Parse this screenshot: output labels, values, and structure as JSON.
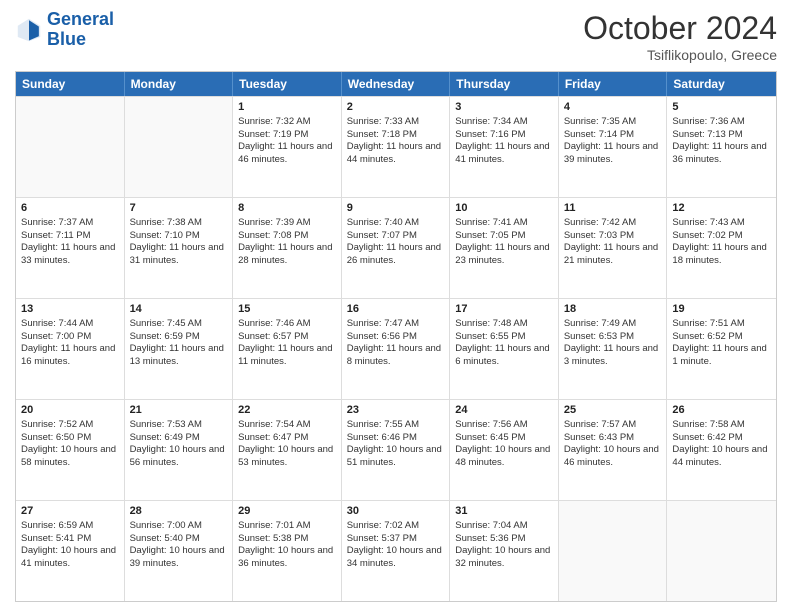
{
  "header": {
    "logo_general": "General",
    "logo_blue": "Blue",
    "month_title": "October 2024",
    "location": "Tsiflikopoulo, Greece"
  },
  "days_of_week": [
    "Sunday",
    "Monday",
    "Tuesday",
    "Wednesday",
    "Thursday",
    "Friday",
    "Saturday"
  ],
  "weeks": [
    [
      {
        "day": "",
        "sunrise": "",
        "sunset": "",
        "daylight": ""
      },
      {
        "day": "",
        "sunrise": "",
        "sunset": "",
        "daylight": ""
      },
      {
        "day": "1",
        "sunrise": "Sunrise: 7:32 AM",
        "sunset": "Sunset: 7:19 PM",
        "daylight": "Daylight: 11 hours and 46 minutes."
      },
      {
        "day": "2",
        "sunrise": "Sunrise: 7:33 AM",
        "sunset": "Sunset: 7:18 PM",
        "daylight": "Daylight: 11 hours and 44 minutes."
      },
      {
        "day": "3",
        "sunrise": "Sunrise: 7:34 AM",
        "sunset": "Sunset: 7:16 PM",
        "daylight": "Daylight: 11 hours and 41 minutes."
      },
      {
        "day": "4",
        "sunrise": "Sunrise: 7:35 AM",
        "sunset": "Sunset: 7:14 PM",
        "daylight": "Daylight: 11 hours and 39 minutes."
      },
      {
        "day": "5",
        "sunrise": "Sunrise: 7:36 AM",
        "sunset": "Sunset: 7:13 PM",
        "daylight": "Daylight: 11 hours and 36 minutes."
      }
    ],
    [
      {
        "day": "6",
        "sunrise": "Sunrise: 7:37 AM",
        "sunset": "Sunset: 7:11 PM",
        "daylight": "Daylight: 11 hours and 33 minutes."
      },
      {
        "day": "7",
        "sunrise": "Sunrise: 7:38 AM",
        "sunset": "Sunset: 7:10 PM",
        "daylight": "Daylight: 11 hours and 31 minutes."
      },
      {
        "day": "8",
        "sunrise": "Sunrise: 7:39 AM",
        "sunset": "Sunset: 7:08 PM",
        "daylight": "Daylight: 11 hours and 28 minutes."
      },
      {
        "day": "9",
        "sunrise": "Sunrise: 7:40 AM",
        "sunset": "Sunset: 7:07 PM",
        "daylight": "Daylight: 11 hours and 26 minutes."
      },
      {
        "day": "10",
        "sunrise": "Sunrise: 7:41 AM",
        "sunset": "Sunset: 7:05 PM",
        "daylight": "Daylight: 11 hours and 23 minutes."
      },
      {
        "day": "11",
        "sunrise": "Sunrise: 7:42 AM",
        "sunset": "Sunset: 7:03 PM",
        "daylight": "Daylight: 11 hours and 21 minutes."
      },
      {
        "day": "12",
        "sunrise": "Sunrise: 7:43 AM",
        "sunset": "Sunset: 7:02 PM",
        "daylight": "Daylight: 11 hours and 18 minutes."
      }
    ],
    [
      {
        "day": "13",
        "sunrise": "Sunrise: 7:44 AM",
        "sunset": "Sunset: 7:00 PM",
        "daylight": "Daylight: 11 hours and 16 minutes."
      },
      {
        "day": "14",
        "sunrise": "Sunrise: 7:45 AM",
        "sunset": "Sunset: 6:59 PM",
        "daylight": "Daylight: 11 hours and 13 minutes."
      },
      {
        "day": "15",
        "sunrise": "Sunrise: 7:46 AM",
        "sunset": "Sunset: 6:57 PM",
        "daylight": "Daylight: 11 hours and 11 minutes."
      },
      {
        "day": "16",
        "sunrise": "Sunrise: 7:47 AM",
        "sunset": "Sunset: 6:56 PM",
        "daylight": "Daylight: 11 hours and 8 minutes."
      },
      {
        "day": "17",
        "sunrise": "Sunrise: 7:48 AM",
        "sunset": "Sunset: 6:55 PM",
        "daylight": "Daylight: 11 hours and 6 minutes."
      },
      {
        "day": "18",
        "sunrise": "Sunrise: 7:49 AM",
        "sunset": "Sunset: 6:53 PM",
        "daylight": "Daylight: 11 hours and 3 minutes."
      },
      {
        "day": "19",
        "sunrise": "Sunrise: 7:51 AM",
        "sunset": "Sunset: 6:52 PM",
        "daylight": "Daylight: 11 hours and 1 minute."
      }
    ],
    [
      {
        "day": "20",
        "sunrise": "Sunrise: 7:52 AM",
        "sunset": "Sunset: 6:50 PM",
        "daylight": "Daylight: 10 hours and 58 minutes."
      },
      {
        "day": "21",
        "sunrise": "Sunrise: 7:53 AM",
        "sunset": "Sunset: 6:49 PM",
        "daylight": "Daylight: 10 hours and 56 minutes."
      },
      {
        "day": "22",
        "sunrise": "Sunrise: 7:54 AM",
        "sunset": "Sunset: 6:47 PM",
        "daylight": "Daylight: 10 hours and 53 minutes."
      },
      {
        "day": "23",
        "sunrise": "Sunrise: 7:55 AM",
        "sunset": "Sunset: 6:46 PM",
        "daylight": "Daylight: 10 hours and 51 minutes."
      },
      {
        "day": "24",
        "sunrise": "Sunrise: 7:56 AM",
        "sunset": "Sunset: 6:45 PM",
        "daylight": "Daylight: 10 hours and 48 minutes."
      },
      {
        "day": "25",
        "sunrise": "Sunrise: 7:57 AM",
        "sunset": "Sunset: 6:43 PM",
        "daylight": "Daylight: 10 hours and 46 minutes."
      },
      {
        "day": "26",
        "sunrise": "Sunrise: 7:58 AM",
        "sunset": "Sunset: 6:42 PM",
        "daylight": "Daylight: 10 hours and 44 minutes."
      }
    ],
    [
      {
        "day": "27",
        "sunrise": "Sunrise: 6:59 AM",
        "sunset": "Sunset: 5:41 PM",
        "daylight": "Daylight: 10 hours and 41 minutes."
      },
      {
        "day": "28",
        "sunrise": "Sunrise: 7:00 AM",
        "sunset": "Sunset: 5:40 PM",
        "daylight": "Daylight: 10 hours and 39 minutes."
      },
      {
        "day": "29",
        "sunrise": "Sunrise: 7:01 AM",
        "sunset": "Sunset: 5:38 PM",
        "daylight": "Daylight: 10 hours and 36 minutes."
      },
      {
        "day": "30",
        "sunrise": "Sunrise: 7:02 AM",
        "sunset": "Sunset: 5:37 PM",
        "daylight": "Daylight: 10 hours and 34 minutes."
      },
      {
        "day": "31",
        "sunrise": "Sunrise: 7:04 AM",
        "sunset": "Sunset: 5:36 PM",
        "daylight": "Daylight: 10 hours and 32 minutes."
      },
      {
        "day": "",
        "sunrise": "",
        "sunset": "",
        "daylight": ""
      },
      {
        "day": "",
        "sunrise": "",
        "sunset": "",
        "daylight": ""
      }
    ]
  ]
}
